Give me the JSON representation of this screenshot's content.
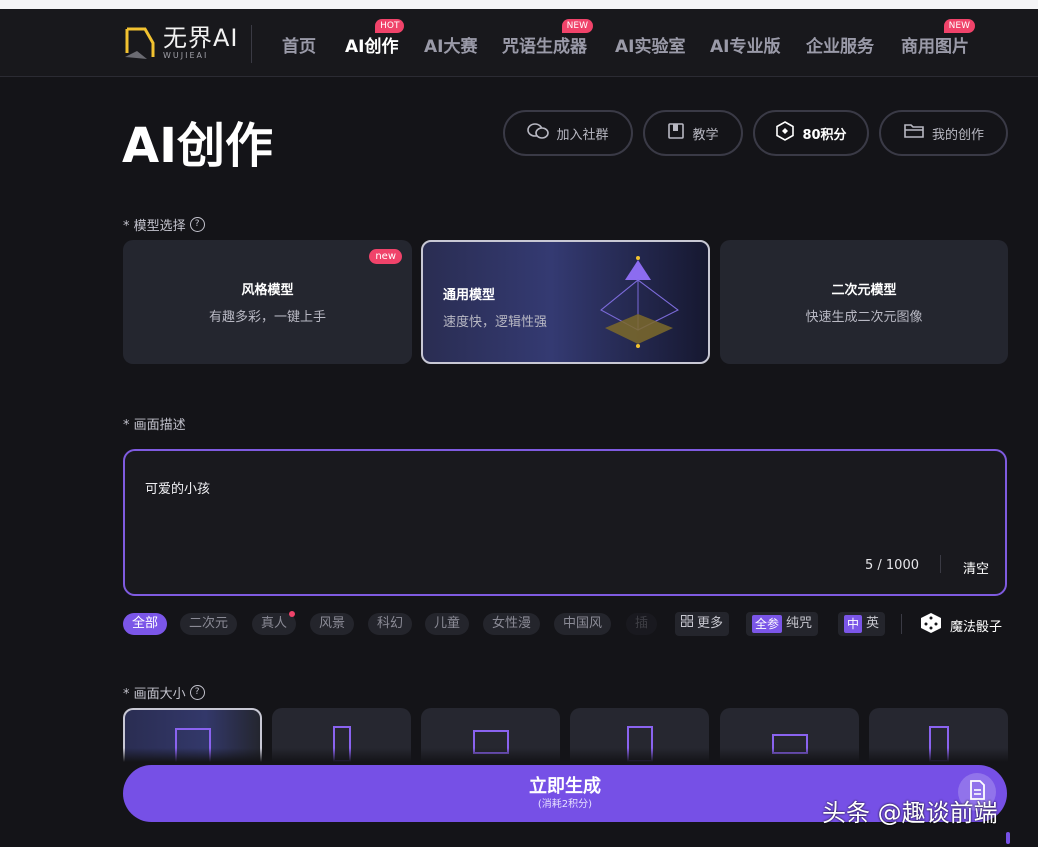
{
  "logo": {
    "cn": "无界AI",
    "en": "WUJIEAI"
  },
  "nav": [
    {
      "label": "首页"
    },
    {
      "label": "AI创作",
      "badge": "HOT",
      "active": true
    },
    {
      "label": "AI大赛"
    },
    {
      "label": "咒语生成器",
      "badge": "NEW"
    },
    {
      "label": "AI实验室"
    },
    {
      "label": "AI专业版"
    },
    {
      "label": "企业服务"
    },
    {
      "label": "商用图片",
      "badge": "NEW"
    }
  ],
  "page_title": "AI创作",
  "actions": {
    "join": "加入社群",
    "tutorial": "教学",
    "points": "80积分",
    "my_works": "我的创作"
  },
  "model_section": {
    "label": "* 模型选择",
    "cards": [
      {
        "title": "风格模型",
        "subtitle": "有趣多彩，一键上手",
        "badge": "new"
      },
      {
        "title": "通用模型",
        "subtitle": "速度快，逻辑性强",
        "selected": true
      },
      {
        "title": "二次元模型",
        "subtitle": "快速生成二次元图像"
      }
    ]
  },
  "prompt_section": {
    "label": "* 画面描述",
    "value": "可爱的小孩",
    "count": "5 / 1000",
    "clear": "清空"
  },
  "tags": [
    "全部",
    "二次元",
    "真人",
    "风景",
    "科幻",
    "儿童",
    "女性漫",
    "中国风",
    "插"
  ],
  "tools": {
    "more": "更多",
    "full": "全参",
    "pure": "纯咒",
    "zh": "中",
    "en": "英",
    "dice": "魔法骰子"
  },
  "size_section": {
    "label": "* 画面大小"
  },
  "generate": {
    "title": "立即生成",
    "subtitle": "(消耗2积分)"
  },
  "watermark": "头条 @趣谈前端",
  "colors": {
    "accent": "#7650e6",
    "badge": "#f0436a",
    "bg": "#141418",
    "card": "#24262f"
  }
}
